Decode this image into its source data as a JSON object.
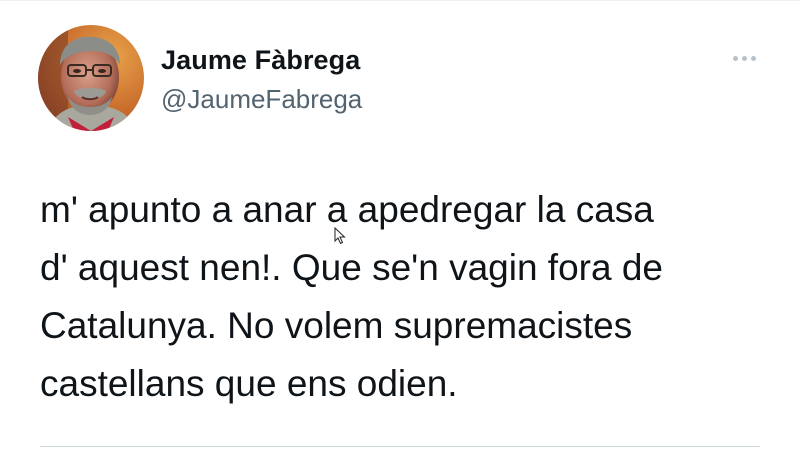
{
  "author": {
    "display_name": "Jaume Fàbrega",
    "handle": "@JaumeFabrega",
    "avatar_icon": "profile-photo"
  },
  "more_options_icon": "ellipsis-horizontal-icon",
  "tweet": {
    "line1": "m' apunto a anar a apedregar la casa",
    "line2": "d' aquest nen!. Que se'n vagin fora de",
    "line3": "Catalunya. No volem supremacistes",
    "line4": "castellans que ens odien."
  },
  "colors": {
    "text": "#0f1419",
    "secondary_text": "#536471",
    "icon_gray": "#b8c2cb",
    "divider": "#cfd9de"
  }
}
